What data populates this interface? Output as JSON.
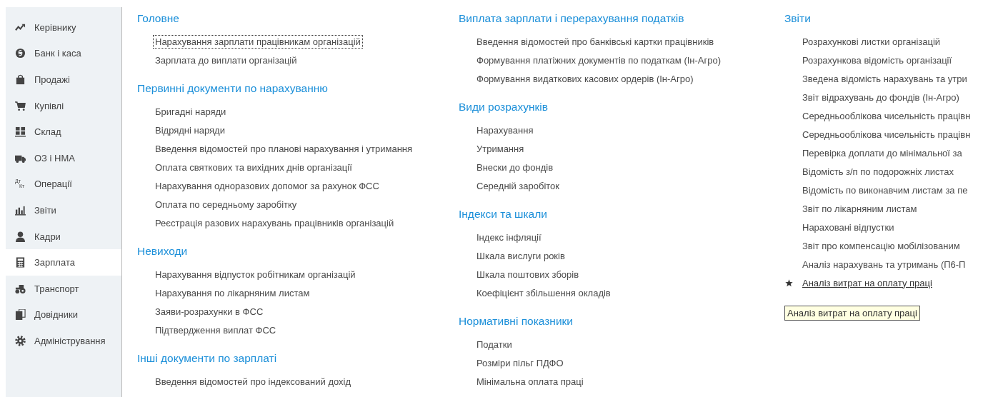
{
  "sidebar": {
    "items": [
      {
        "label": "Керівнику",
        "selected": false
      },
      {
        "label": "Банк і каса",
        "selected": false
      },
      {
        "label": "Продажі",
        "selected": false
      },
      {
        "label": "Купівлі",
        "selected": false
      },
      {
        "label": "Склад",
        "selected": false
      },
      {
        "label": "ОЗ і НМА",
        "selected": false
      },
      {
        "label": "Операції",
        "selected": false,
        "icon_text": [
          "Дт",
          "Кт"
        ]
      },
      {
        "label": "Звіти",
        "selected": false
      },
      {
        "label": "Кадри",
        "selected": false
      },
      {
        "label": "Зарплата",
        "selected": true
      },
      {
        "label": "Транспорт",
        "selected": false
      },
      {
        "label": "Довідники",
        "selected": false
      },
      {
        "label": "Адміністрування",
        "selected": false
      }
    ]
  },
  "columns": [
    {
      "sections": [
        {
          "title": "Головне",
          "items": [
            {
              "label": "Нарахування зарплати працівникам організацій",
              "focused": true
            },
            {
              "label": "Зарплата до виплати організацій"
            }
          ]
        },
        {
          "title": "Первинні документи по нарахуванню",
          "items": [
            {
              "label": "Бригадні наряди"
            },
            {
              "label": "Відрядні наряди"
            },
            {
              "label": "Введення відомостей про планові нарахування і утримання"
            },
            {
              "label": "Оплата святкових та вихідних днів організації"
            },
            {
              "label": "Нарахування одноразових допомог за рахунок ФСС"
            },
            {
              "label": "Оплата по середньому заробітку"
            },
            {
              "label": "Реєстрація разових нарахувань працівників організацій"
            }
          ]
        },
        {
          "title": "Невиходи",
          "items": [
            {
              "label": "Нарахування відпусток робітникам організацій"
            },
            {
              "label": "Нарахування по лікарняним листам"
            },
            {
              "label": "Заяви-розрахунки в ФСС"
            },
            {
              "label": "Підтвердження виплат ФСС"
            }
          ]
        },
        {
          "title": "Інші документи по зарплаті",
          "items": [
            {
              "label": "Введення відомостей про індексований дохід"
            }
          ]
        }
      ]
    },
    {
      "sections": [
        {
          "title": "Виплата зарплати і перерахування податків",
          "items": [
            {
              "label": "Введення відомостей про банківські картки працівників"
            },
            {
              "label": "Формування платіжних документів по податкам (Ін-Агро)"
            },
            {
              "label": "Формування видаткових касових ордерів (Ін-Агро)"
            }
          ]
        },
        {
          "title": "Види розрахунків",
          "items": [
            {
              "label": "Нарахування"
            },
            {
              "label": "Утримання"
            },
            {
              "label": "Внески до фондів"
            },
            {
              "label": "Середній заробіток"
            }
          ]
        },
        {
          "title": "Індекси та шкали",
          "items": [
            {
              "label": "Індекс інфляції"
            },
            {
              "label": "Шкала вислуги років"
            },
            {
              "label": "Шкала поштових зборів"
            },
            {
              "label": "Коефіцієнт збільшення окладів"
            }
          ]
        },
        {
          "title": "Нормативні показники",
          "items": [
            {
              "label": "Податки"
            },
            {
              "label": "Розміри пільг ПДФО"
            },
            {
              "label": "Мінімальна оплата праці"
            }
          ]
        }
      ]
    },
    {
      "sections": [
        {
          "title": "Звіти",
          "items": [
            {
              "label": "Розрахункові листки організацій"
            },
            {
              "label": "Розрахункова відомість організації"
            },
            {
              "label": "Зведена відомість нарахувань та утри"
            },
            {
              "label": "Звіт відрахувань до фондів (Ін-Агро)"
            },
            {
              "label": "Середньооблікова чисельність працівн"
            },
            {
              "label": "Середньооблікова чисельність працівн"
            },
            {
              "label": "Перевірка доплати до мінімальної за"
            },
            {
              "label": "Відомість з/п по подорожніх листах"
            },
            {
              "label": "Відомість по виконавчим листам за пе"
            },
            {
              "label": "Звіт по лікарняним листам"
            },
            {
              "label": "Нараховані відпустки"
            },
            {
              "label": "Звіт про компенсацію мобілізованим"
            },
            {
              "label": "Аналіз нарахувань та утримань (П6-П"
            },
            {
              "label": "Аналіз витрат на оплату праці",
              "favorite": true,
              "hovered": true
            }
          ]
        }
      ],
      "tooltip": "Аналіз витрат на оплату праці"
    }
  ]
}
